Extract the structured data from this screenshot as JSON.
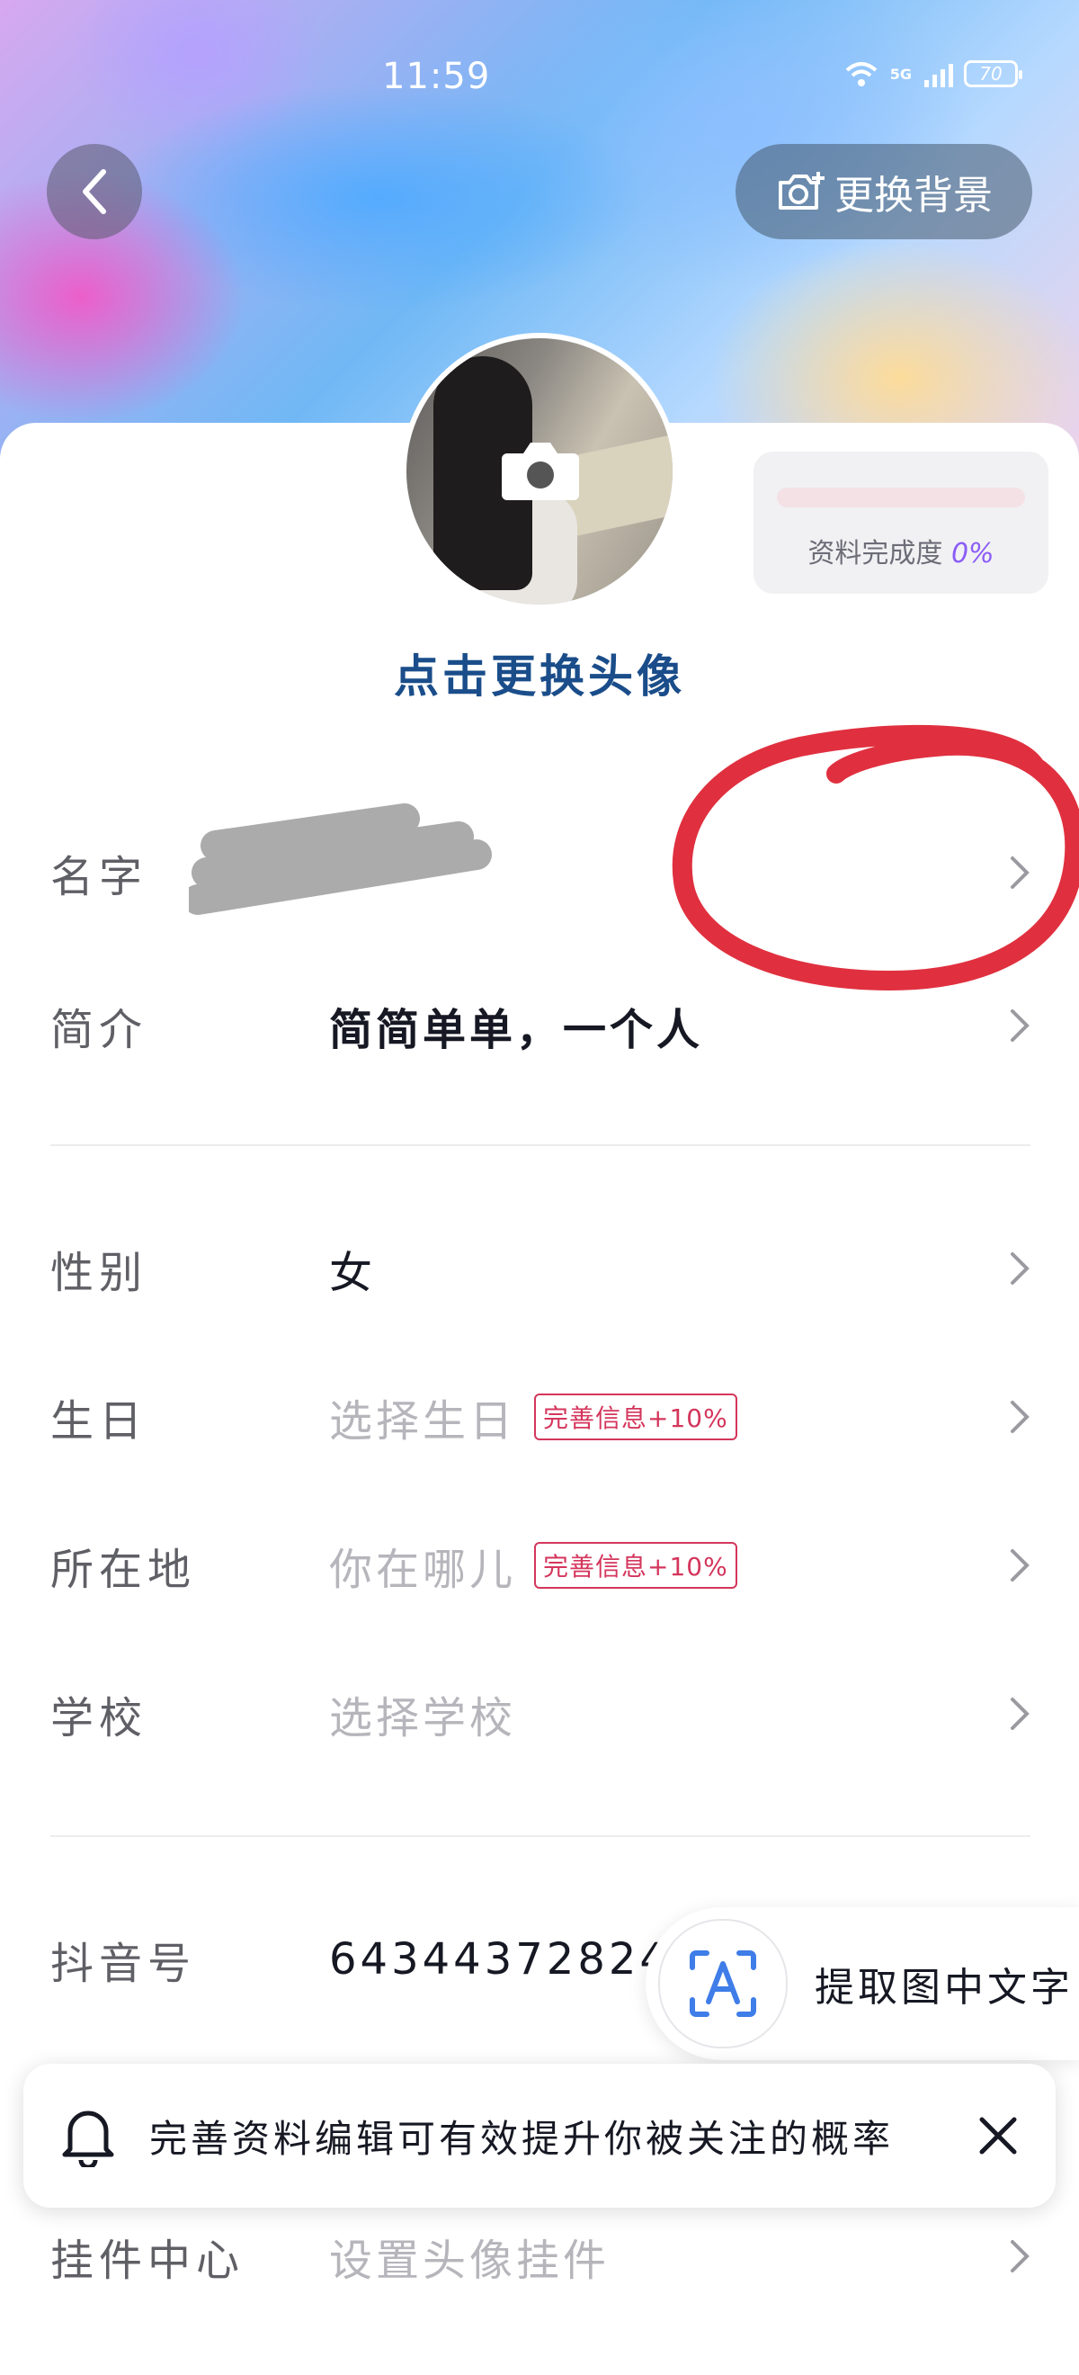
{
  "status_bar": {
    "time": "11:59",
    "network": "5G",
    "battery": "70"
  },
  "header": {
    "back_icon": "chevron-left-icon",
    "change_bg_label": "更换背景"
  },
  "avatar": {
    "change_label": "点击更换头像"
  },
  "completion": {
    "label": "资料完成度",
    "percent_text": "0%",
    "progress": 0
  },
  "fields": {
    "name": {
      "label": "名字"
    },
    "bio": {
      "label": "简介",
      "value": "简简单单，一个人"
    },
    "gender": {
      "label": "性别",
      "value": "女"
    },
    "birthday": {
      "label": "生日",
      "value": "选择生日",
      "tag": "完善信息+10%"
    },
    "location": {
      "label": "所在地",
      "value": "你在哪儿",
      "tag": "完善信息+10%"
    },
    "school": {
      "label": "学校",
      "value": "选择学校"
    },
    "douyin_id": {
      "label": "抖音号",
      "value": "64344372824"
    },
    "pendant": {
      "label": "挂件中心",
      "value": "设置头像挂件"
    }
  },
  "ocr": {
    "label": "提取图中文字"
  },
  "notice": {
    "text": "完善资料编辑可有效提升你被关注的概率"
  },
  "colors": {
    "accent": "#fe2c55",
    "link": "#1a4d8a",
    "annotation": "#e0303f"
  }
}
